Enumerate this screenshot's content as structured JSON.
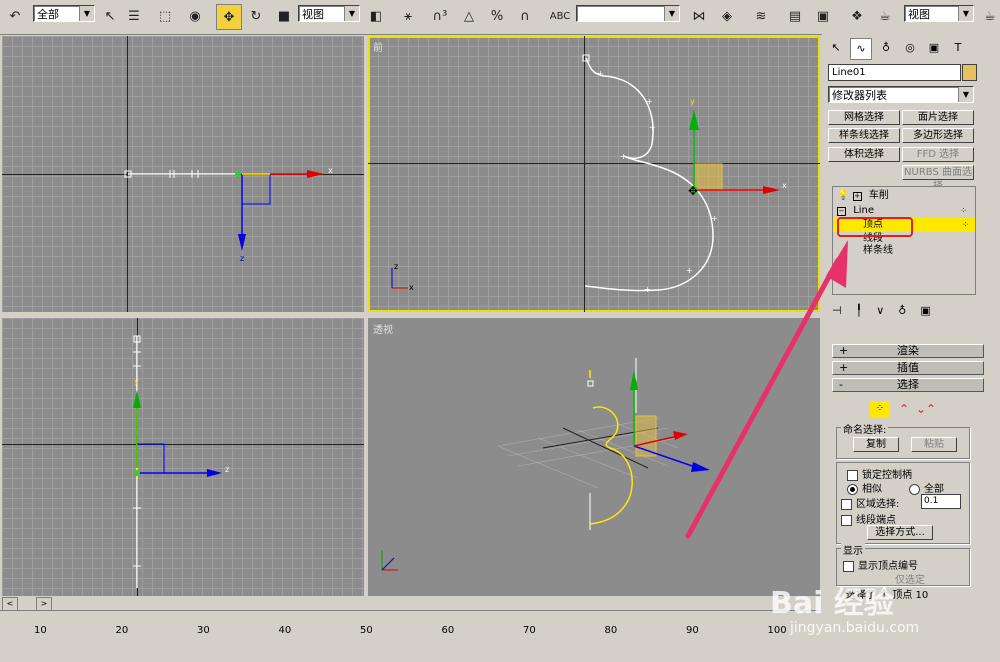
{
  "toolbar": {
    "selection_filter": "全部",
    "ref_coord": "视图",
    "named_selection": "",
    "render_view": "视图"
  },
  "viewports": {
    "front_label": "前",
    "perspective_label": "透视"
  },
  "panel": {
    "object_name": "Line01",
    "object_color": "#e8c060",
    "modifier_list": "修改器列表",
    "buttons": [
      "网格选择",
      "面片选择",
      "样条线选择",
      "多边形选择",
      "体积选择",
      "FFD 选择",
      "NURBS 曲面选择"
    ],
    "stack": {
      "lathe": "车削",
      "line": "Line",
      "vertex": "顶点",
      "segment": "线段",
      "spline": "样条线"
    },
    "rollouts": {
      "render": "渲染",
      "interpolation": "插值",
      "selection": "选择"
    },
    "named_sel_label": "命名选择:",
    "copy": "复制",
    "paste": "粘贴",
    "lock_handles": "锁定控制柄",
    "similar": "相似",
    "all": "全部",
    "area_select": "区域选择:",
    "area_value": "0.1",
    "segment_end": "线段端点",
    "select_by": "选择方式...",
    "display_label": "显示",
    "show_vertex_numbers": "显示顶点编号",
    "only_selected": "仅选定",
    "selected_text": "选择了 个 顶点 10"
  },
  "ruler": {
    "ticks": [
      "10",
      "20",
      "30",
      "40",
      "50",
      "60",
      "70",
      "80",
      "90",
      "100"
    ]
  },
  "colors": {
    "highlight": "#ffe800",
    "annotation_arrow": "#e8306a",
    "annotation_box": "#e02020"
  },
  "watermark": {
    "brand": "Bai 经验",
    "url": "jingyan.baidu.com"
  }
}
